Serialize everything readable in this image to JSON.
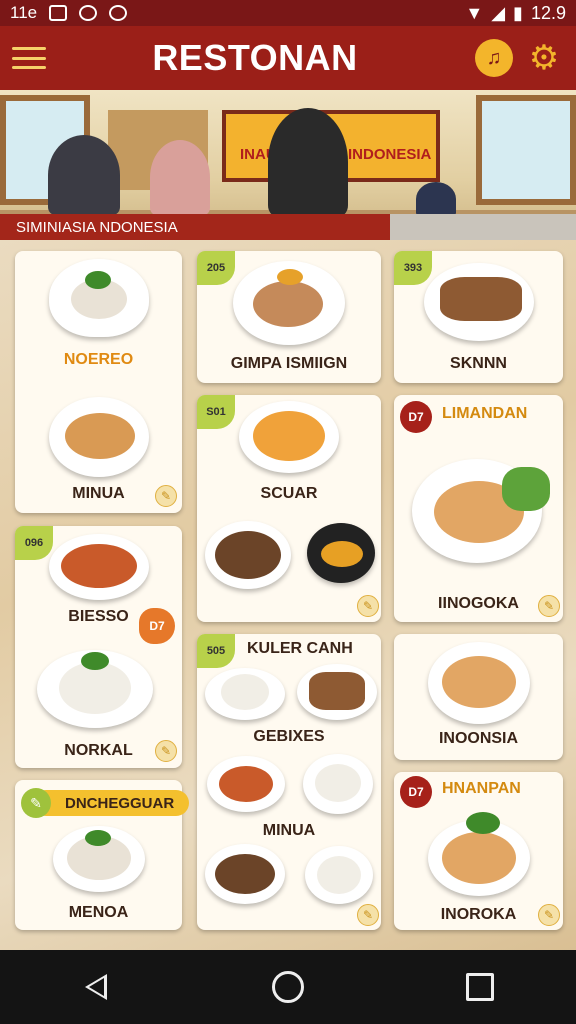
{
  "status_bar": {
    "left_text": "11e",
    "time": "12.9"
  },
  "app": {
    "title": "RESTONAN"
  },
  "hero": {
    "caption": "SIMINIASIA NDONESIA",
    "sign_left": "INAUN",
    "sign_right": "INDONESIA"
  },
  "cards": {
    "c1": {
      "top_label": "NOEREO",
      "bottom_label": "MINUA"
    },
    "c2": {
      "badge": "205",
      "label": "GIMPA ISMIIGN"
    },
    "c3": {
      "badge": "393",
      "label": "SKNNN"
    },
    "c4": {
      "badge": "S01",
      "label": "SCUAR"
    },
    "c5": {
      "badge": "D7",
      "heading": "LIMANDAN",
      "label": "IINOGOKA"
    },
    "c6": {
      "badge": "096",
      "badge2": "D7",
      "top_label": "BIESSO",
      "bottom_label": "NORKAL"
    },
    "c7": {
      "badge": "505",
      "heading": "KULER CANH",
      "mid_label": "GEBIXES",
      "bottom_label": "MINUA"
    },
    "c8": {
      "label": "INOONSIA"
    },
    "c9": {
      "pill": "DNCHEGGUAR",
      "label": "MENOA"
    },
    "c10": {
      "badge": "D7",
      "heading": "HNANPAN",
      "label": "INOROKA"
    }
  },
  "colors": {
    "appbar": "#9b1f18",
    "accent": "#f3b52b",
    "badge_green": "#b8d14a",
    "badge_red": "#a6211a"
  }
}
